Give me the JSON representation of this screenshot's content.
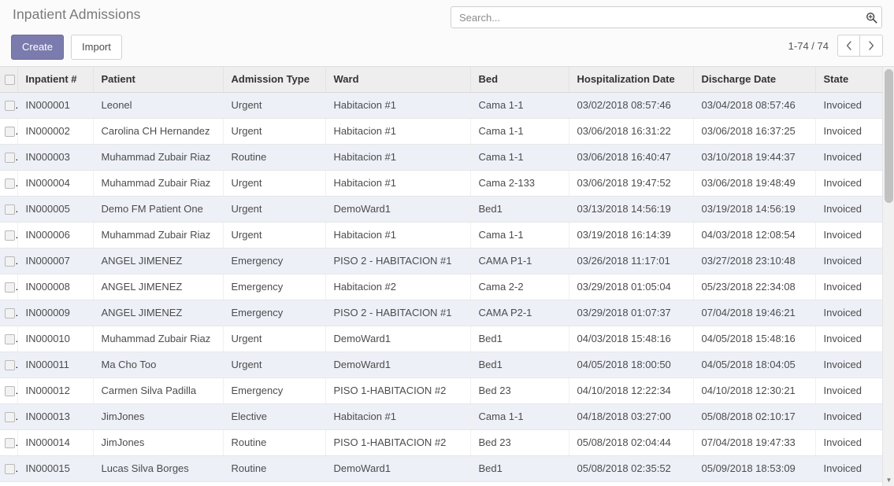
{
  "control_panel": {
    "title": "Inpatient Admissions",
    "create_label": "Create",
    "import_label": "Import",
    "search": {
      "placeholder": "Search...",
      "value": "",
      "icon": "search-zoom-icon"
    },
    "pager": {
      "range_label": "1-74 / 74",
      "prev_icon": "chevron-left-icon",
      "next_icon": "chevron-right-icon"
    }
  },
  "list": {
    "columns": [
      {
        "key": "select",
        "label": ""
      },
      {
        "key": "reference",
        "label": "Inpatient #"
      },
      {
        "key": "patient",
        "label": "Patient"
      },
      {
        "key": "admission",
        "label": "Admission Type"
      },
      {
        "key": "ward",
        "label": "Ward"
      },
      {
        "key": "bed",
        "label": "Bed"
      },
      {
        "key": "hosp_date",
        "label": "Hospitalization Date"
      },
      {
        "key": "disc_date",
        "label": "Discharge Date"
      },
      {
        "key": "state",
        "label": "State"
      }
    ],
    "rows": [
      {
        "reference": "IN000001",
        "patient": "Leonel",
        "admission": "Urgent",
        "ward": "Habitacion #1",
        "bed": "Cama 1-1",
        "hosp_date": "03/02/2018 08:57:46",
        "disc_date": "03/04/2018 08:57:46",
        "state": "Invoiced"
      },
      {
        "reference": "IN000002",
        "patient": "Carolina CH Hernandez",
        "admission": "Urgent",
        "ward": "Habitacion #1",
        "bed": "Cama 1-1",
        "hosp_date": "03/06/2018 16:31:22",
        "disc_date": "03/06/2018 16:37:25",
        "state": "Invoiced"
      },
      {
        "reference": "IN000003",
        "patient": "Muhammad Zubair Riaz",
        "admission": "Routine",
        "ward": "Habitacion #1",
        "bed": "Cama 1-1",
        "hosp_date": "03/06/2018 16:40:47",
        "disc_date": "03/10/2018 19:44:37",
        "state": "Invoiced"
      },
      {
        "reference": "IN000004",
        "patient": "Muhammad Zubair Riaz",
        "admission": "Urgent",
        "ward": "Habitacion #1",
        "bed": "Cama 2-133",
        "hosp_date": "03/06/2018 19:47:52",
        "disc_date": "03/06/2018 19:48:49",
        "state": "Invoiced"
      },
      {
        "reference": "IN000005",
        "patient": "Demo FM Patient One",
        "admission": "Urgent",
        "ward": "DemoWard1",
        "bed": "Bed1",
        "hosp_date": "03/13/2018 14:56:19",
        "disc_date": "03/19/2018 14:56:19",
        "state": "Invoiced"
      },
      {
        "reference": "IN000006",
        "patient": "Muhammad Zubair Riaz",
        "admission": "Urgent",
        "ward": "Habitacion #1",
        "bed": "Cama 1-1",
        "hosp_date": "03/19/2018 16:14:39",
        "disc_date": "04/03/2018 12:08:54",
        "state": "Invoiced"
      },
      {
        "reference": "IN000007",
        "patient": "ANGEL JIMENEZ",
        "admission": "Emergency",
        "ward": "PISO 2 - HABITACION #1",
        "bed": "CAMA P1-1",
        "hosp_date": "03/26/2018 11:17:01",
        "disc_date": "03/27/2018 23:10:48",
        "state": "Invoiced"
      },
      {
        "reference": "IN000008",
        "patient": "ANGEL JIMENEZ",
        "admission": "Emergency",
        "ward": "Habitacion #2",
        "bed": "Cama 2-2",
        "hosp_date": "03/29/2018 01:05:04",
        "disc_date": "05/23/2018 22:34:08",
        "state": "Invoiced"
      },
      {
        "reference": "IN000009",
        "patient": "ANGEL JIMENEZ",
        "admission": "Emergency",
        "ward": "PISO 2 - HABITACION #1",
        "bed": "CAMA P2-1",
        "hosp_date": "03/29/2018 01:07:37",
        "disc_date": "07/04/2018 19:46:21",
        "state": "Invoiced"
      },
      {
        "reference": "IN000010",
        "patient": "Muhammad Zubair Riaz",
        "admission": "Urgent",
        "ward": "DemoWard1",
        "bed": "Bed1",
        "hosp_date": "04/03/2018 15:48:16",
        "disc_date": "04/05/2018 15:48:16",
        "state": "Invoiced"
      },
      {
        "reference": "IN000011",
        "patient": "Ma Cho Too",
        "admission": "Urgent",
        "ward": "DemoWard1",
        "bed": "Bed1",
        "hosp_date": "04/05/2018 18:00:50",
        "disc_date": "04/05/2018 18:04:05",
        "state": "Invoiced"
      },
      {
        "reference": "IN000012",
        "patient": "Carmen Silva Padilla",
        "admission": "Emergency",
        "ward": "PISO 1-HABITACION #2",
        "bed": "Bed 23",
        "hosp_date": "04/10/2018 12:22:34",
        "disc_date": "04/10/2018 12:30:21",
        "state": "Invoiced"
      },
      {
        "reference": "IN000013",
        "patient": "JimJones",
        "admission": "Elective",
        "ward": "Habitacion #1",
        "bed": "Cama 1-1",
        "hosp_date": "04/18/2018 03:27:00",
        "disc_date": "05/08/2018 02:10:17",
        "state": "Invoiced"
      },
      {
        "reference": "IN000014",
        "patient": "JimJones",
        "admission": "Routine",
        "ward": "PISO 1-HABITACION #2",
        "bed": "Bed 23",
        "hosp_date": "05/08/2018 02:04:44",
        "disc_date": "07/04/2018 19:47:33",
        "state": "Invoiced"
      },
      {
        "reference": "IN000015",
        "patient": "Lucas Silva Borges",
        "admission": "Routine",
        "ward": "DemoWard1",
        "bed": "Bed1",
        "hosp_date": "05/08/2018 02:35:52",
        "disc_date": "05/09/2018 18:53:09",
        "state": "Invoiced"
      }
    ]
  },
  "colors": {
    "accent": "#7c7bad",
    "header_bg": "#eeeeee",
    "row_alt": "#eef0f8",
    "panel_bg": "#fbfbfb"
  }
}
